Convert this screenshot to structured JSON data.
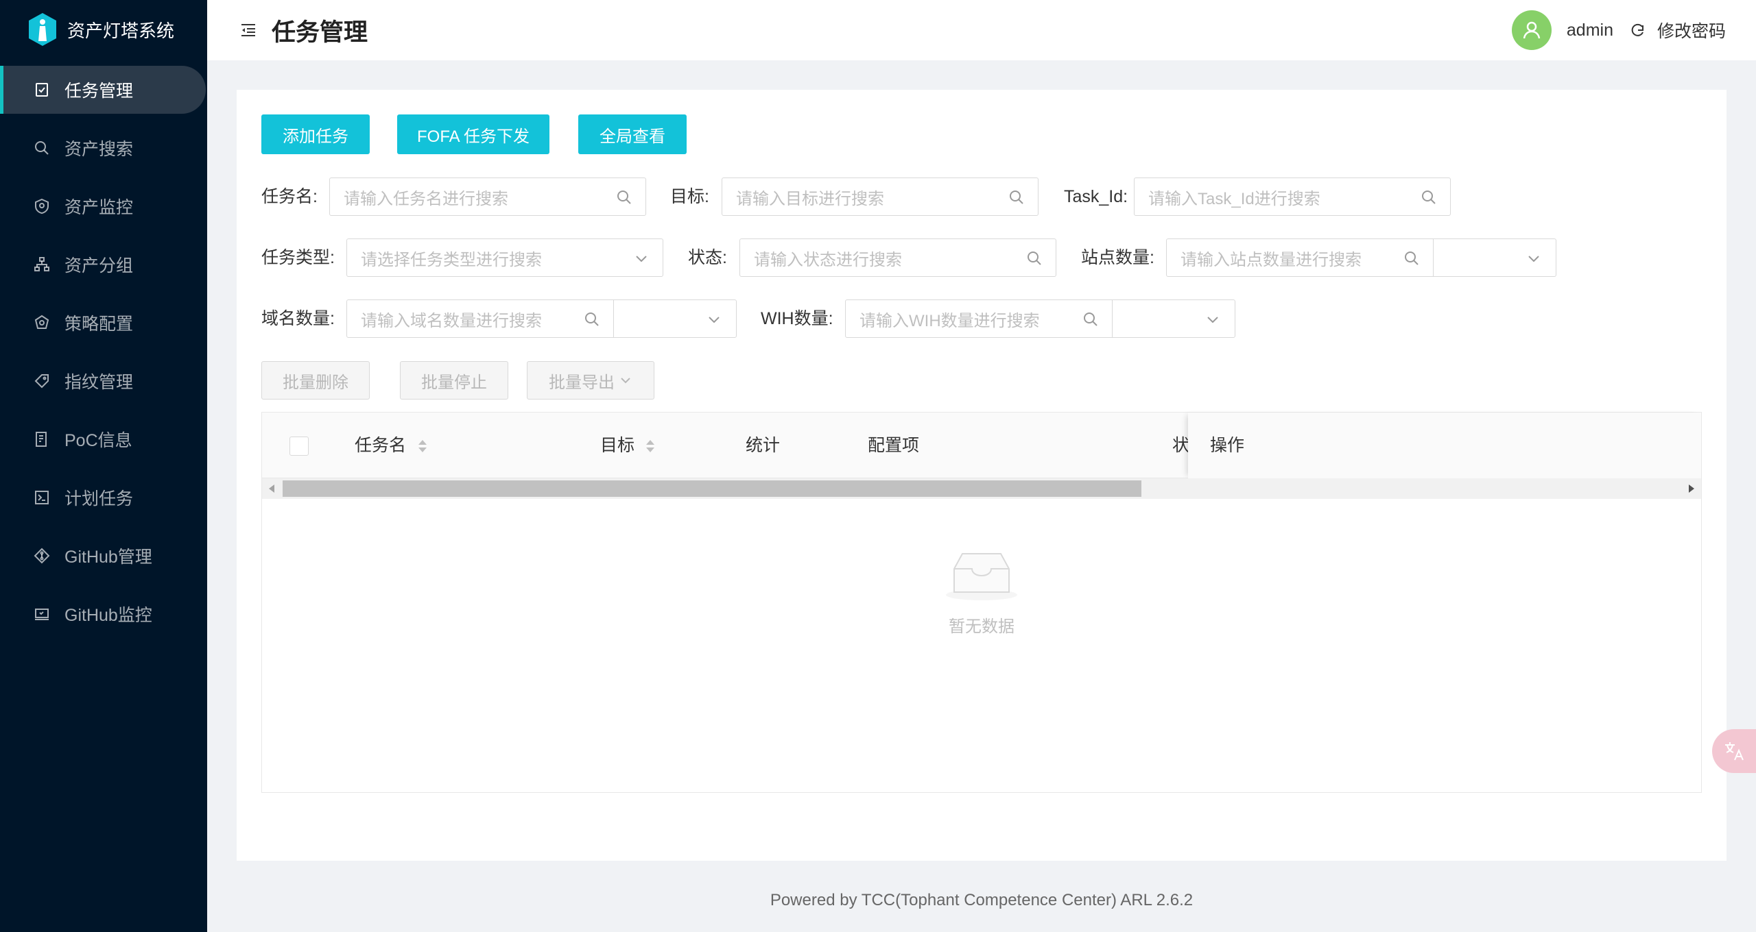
{
  "app": {
    "title": "资产灯塔系统"
  },
  "sidebar": {
    "items": [
      {
        "label": "任务管理",
        "icon": "task-icon",
        "active": true
      },
      {
        "label": "资产搜索",
        "icon": "search-icon"
      },
      {
        "label": "资产监控",
        "icon": "shield-icon"
      },
      {
        "label": "资产分组",
        "icon": "group-icon"
      },
      {
        "label": "策略配置",
        "icon": "policy-icon"
      },
      {
        "label": "指纹管理",
        "icon": "tag-icon"
      },
      {
        "label": "PoC信息",
        "icon": "document-icon"
      },
      {
        "label": "计划任务",
        "icon": "schedule-icon"
      },
      {
        "label": "GitHub管理",
        "icon": "github-icon"
      },
      {
        "label": "GitHub监控",
        "icon": "monitor-icon"
      }
    ]
  },
  "header": {
    "title": "任务管理",
    "username": "admin",
    "change_password": "修改密码"
  },
  "actions": {
    "add_task": "添加任务",
    "fofa_task": "FOFA 任务下发",
    "global_view": "全局查看"
  },
  "filters": {
    "task_name": {
      "label": "任务名:",
      "placeholder": "请输入任务名进行搜索"
    },
    "target": {
      "label": "目标:",
      "placeholder": "请输入目标进行搜索"
    },
    "task_id": {
      "label": "Task_Id:",
      "placeholder": "请输入Task_Id进行搜索"
    },
    "task_type": {
      "label": "任务类型:",
      "placeholder": "请选择任务类型进行搜索"
    },
    "status": {
      "label": "状态:",
      "placeholder": "请输入状态进行搜索"
    },
    "site_count": {
      "label": "站点数量:",
      "placeholder": "请输入站点数量进行搜索"
    },
    "domain_count": {
      "label": "域名数量:",
      "placeholder": "请输入域名数量进行搜索"
    },
    "wih_count": {
      "label": "WIH数量:",
      "placeholder": "请输入WIH数量进行搜索"
    }
  },
  "batch": {
    "delete": "批量删除",
    "stop": "批量停止",
    "export": "批量导出"
  },
  "table": {
    "columns": [
      "任务名",
      "目标",
      "统计",
      "配置项",
      "状",
      "操作"
    ],
    "empty_text": "暂无数据"
  },
  "footer": {
    "text": "Powered by TCC(Tophant Competence Center) ARL 2.6.2"
  },
  "colors": {
    "primary": "#13c2d9",
    "sidebar_bg": "#001529",
    "avatar_bg": "#87d068"
  }
}
